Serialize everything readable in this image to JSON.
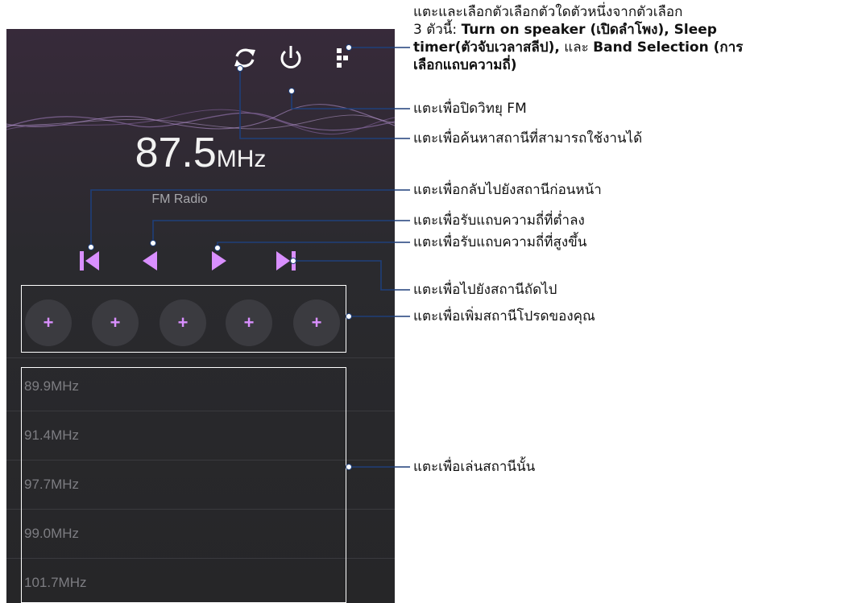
{
  "radio": {
    "frequency_value": "87.5",
    "frequency_unit": "MHz",
    "band_label": "FM Radio",
    "favorites": [
      "+",
      "+",
      "+",
      "+",
      "+"
    ],
    "stations": [
      {
        "value": "89.9",
        "unit": "MHz"
      },
      {
        "value": "91.4",
        "unit": "MHz"
      },
      {
        "value": "97.7",
        "unit": "MHz"
      },
      {
        "value": "99.0",
        "unit": "MHz"
      },
      {
        "value": "101.7",
        "unit": "MHz"
      }
    ],
    "icons": [
      "refresh-icon",
      "power-icon",
      "more-menu-icon",
      "skip-previous-icon",
      "tune-down-icon",
      "tune-up-icon",
      "skip-next-icon"
    ],
    "colors": {
      "accent": "#d98fff",
      "background": "#2a2a2e"
    }
  },
  "callouts": {
    "menu_line1": "แตะและเลือกตัวเลือกตัวใดตัวหนึ่งจากตัวเลือก",
    "menu_line2_pre": "3 ตัวนี้: ",
    "menu_line2_bold": "Turn on speaker (เปิดลำโพง), Sleep",
    "menu_line3_bold1": "timer(ตัวจับเวลาสลีป),",
    "menu_line3_mid": " และ ",
    "menu_line3_bold2": "Band Selection (การ",
    "menu_line4_bold": "เลือกแถบความถี่)",
    "power": "แตะเพื่อปิดวิทยุ FM",
    "scan": "แตะเพื่อค้นหาสถานีที่สามารถใช้งานได้",
    "previous": "แตะเพื่อกลับไปยังสถานีก่อนหน้า",
    "tune_down": "แตะเพื่อรับแถบความถี่ที่ต่ำลง",
    "tune_up": "แตะเพื่อรับแถบความถี่ที่สูงขึ้น",
    "next": "แตะเพื่อไปยังสถานีถัดไป",
    "favorites": "แตะเพื่อเพิ่มสถานีโปรดของคุณ",
    "play": "แตะเพื่อเล่นสถานีนั้น"
  }
}
